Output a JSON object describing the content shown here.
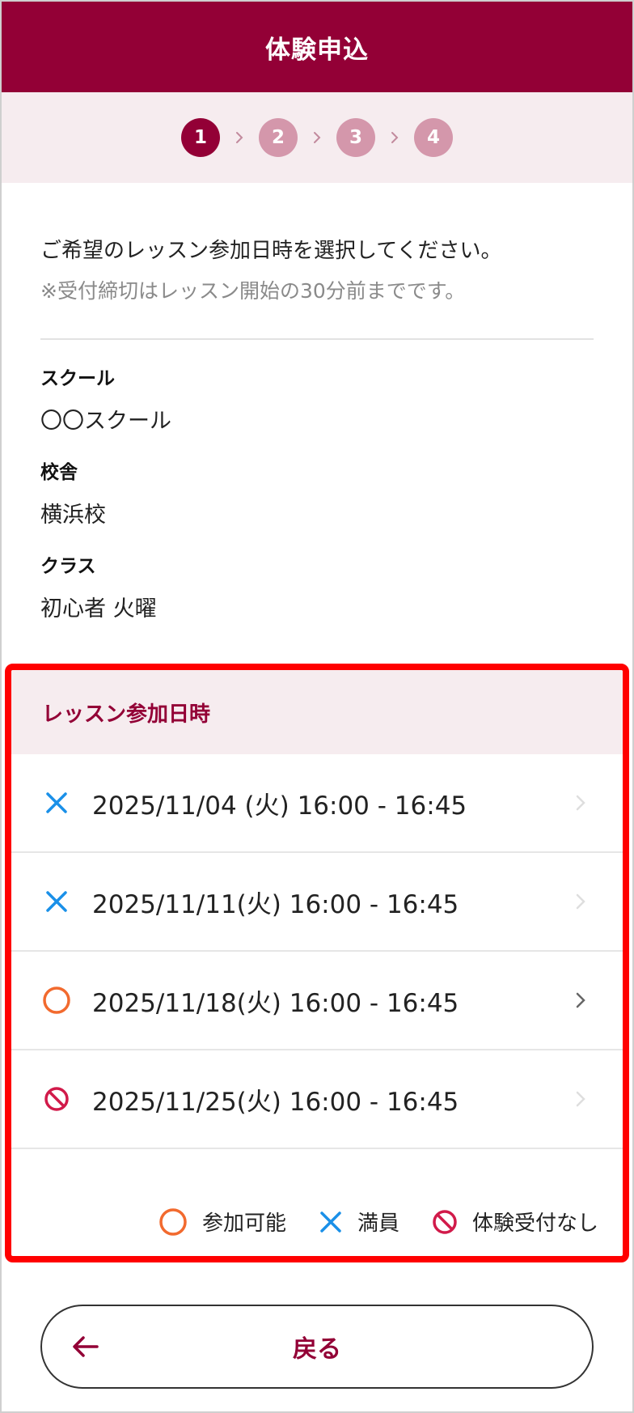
{
  "header": {
    "title": "体験申込"
  },
  "stepper": {
    "steps": [
      "1",
      "2",
      "3",
      "4"
    ],
    "current": 1
  },
  "intro": {
    "main": "ご希望のレッスン参加日時を選択してください。",
    "note": "※受付締切はレッスン開始の30分前までです。"
  },
  "fields": {
    "school_label": "スクール",
    "school_value": "〇〇スクール",
    "campus_label": "校舎",
    "campus_value": "横浜校",
    "class_label": "クラス",
    "class_value": "初心者 火曜"
  },
  "lesson": {
    "title": "レッスン参加日時",
    "slots": [
      {
        "text": "2025/11/04 (火) 16:00 - 16:45",
        "status": "full",
        "icon": "cross-icon"
      },
      {
        "text": "2025/11/11(火) 16:00 - 16:45",
        "status": "full",
        "icon": "cross-icon"
      },
      {
        "text": "2025/11/18(火) 16:00 - 16:45",
        "status": "available",
        "icon": "circle-icon"
      },
      {
        "text": "2025/11/25(火) 16:00 - 16:45",
        "status": "unavailable",
        "icon": "prohibited-icon"
      }
    ],
    "legend": {
      "available": "参加可能",
      "full": "満員",
      "unavailable": "体験受付なし"
    }
  },
  "footer": {
    "back_label": "戻る"
  },
  "colors": {
    "brand": "#930036",
    "brand_light": "#f6ecef",
    "step_inactive": "#d497ab",
    "available": "#f26a2e",
    "full": "#1a90e8",
    "unavailable": "#d11a4a",
    "highlight_border": "#ff0000"
  }
}
